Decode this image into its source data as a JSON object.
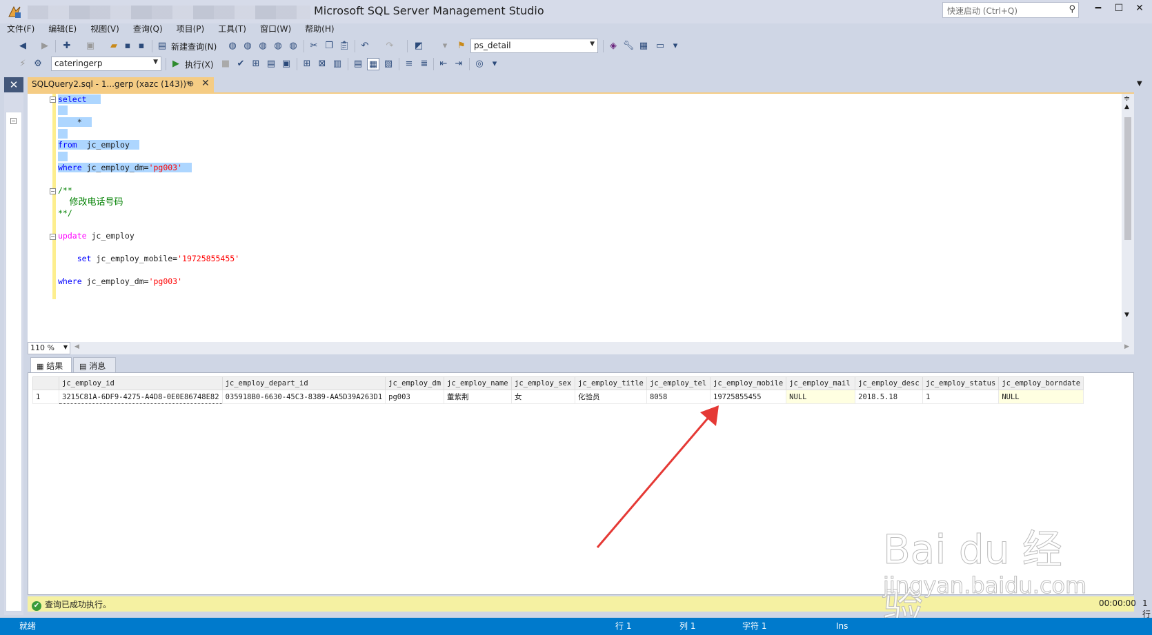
{
  "window": {
    "title": "Microsoft SQL Server Management Studio",
    "quick_launch_placeholder": "快速启动 (Ctrl+Q)",
    "minimize": "━",
    "maximize": "☐",
    "close": "✕"
  },
  "menu": [
    "文件(F)",
    "编辑(E)",
    "视图(V)",
    "查询(Q)",
    "项目(P)",
    "工具(T)",
    "窗口(W)",
    "帮助(H)"
  ],
  "toolbar1": {
    "new_query_label": "新建查询(N)",
    "solution_config": "ps_detail"
  },
  "toolbar2": {
    "database": "cateringerp",
    "execute_label": "执行(X)"
  },
  "doc_tab": {
    "title": "SQLQuery2.sql - 1...gerp (xazc (143))*",
    "pin": "⊕",
    "close": "✕"
  },
  "editor": {
    "zoom": "110 %",
    "lines": [
      {
        "kw": "select"
      },
      {
        "star": "*"
      },
      {
        "kw": "from",
        "ident": "  jc_employ"
      },
      {
        "kw": "where",
        "ident": " jc_employ_dm=",
        "str": "'pg003'"
      },
      {
        "comment": "/**"
      },
      {
        "comment": "    修改电话号码"
      },
      {
        "comment": "**/"
      },
      {
        "kw": "update",
        "ident": " jc_employ"
      },
      {
        "kw": "set",
        "ident": " jc_employ_mobile=",
        "str": "'19725855455'"
      },
      {
        "kw": "where",
        "ident": " jc_employ_dm=",
        "str": "'pg003'"
      }
    ]
  },
  "results": {
    "tab_results": "结果",
    "tab_messages": "消息",
    "columns": [
      "jc_employ_id",
      "jc_employ_depart_id",
      "jc_employ_dm",
      "jc_employ_name",
      "jc_employ_sex",
      "jc_employ_title",
      "jc_employ_tel",
      "jc_employ_mobile",
      "jc_employ_mail",
      "jc_employ_desc",
      "jc_employ_status",
      "jc_employ_borndate"
    ],
    "rows": [
      [
        "1",
        "3215C81A-6DF9-4275-A4D8-0E0E86748E82",
        "035918B0-6630-45C3-8389-AA5D39A263D1",
        "pg003",
        "董紫荆",
        "女",
        "化验员",
        "8058",
        "19725855455",
        "NULL",
        "2018.5.18",
        "1",
        "NULL"
      ]
    ]
  },
  "query_status": {
    "message": "查询已成功执行。",
    "elapsed": "00:00:00",
    "row_count": "1 行"
  },
  "status_bar": {
    "ready": "就绪",
    "line": "行 1",
    "col": "列 1",
    "char": "字符 1",
    "mode": "Ins"
  },
  "watermark": {
    "brand": "Bai du 经验",
    "url": "jingyan.baidu.com"
  },
  "colors": {
    "accent": "#007acc",
    "tab_active": "#f5cc84",
    "keyword": "#0000ff",
    "string": "#ff0000",
    "comment": "#008000",
    "arrow": "#e53935"
  }
}
